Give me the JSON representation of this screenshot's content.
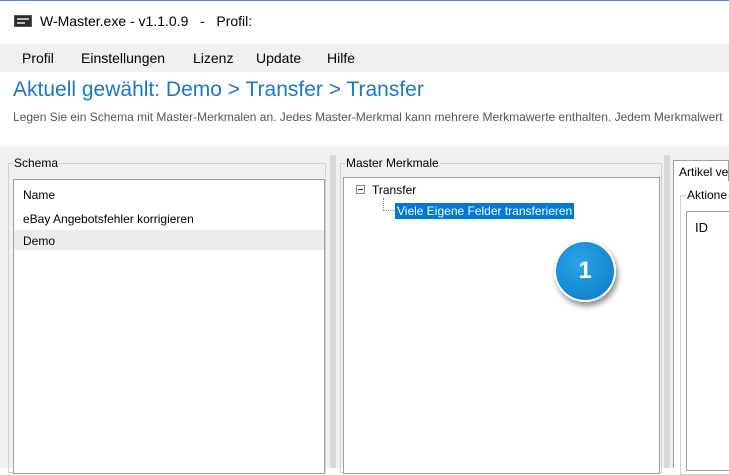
{
  "window": {
    "title": "W-Master.exe - v1.1.0.9   -   Profil:",
    "icon": "app-logo-icon"
  },
  "menu": {
    "items": [
      "Profil",
      "Einstellungen",
      "Lizenz",
      "Update",
      "Hilfe"
    ]
  },
  "header": {
    "current_selection": "Aktuell gewählt: Demo > Transfer > Transfer",
    "description": "Legen Sie ein Schema mit Master-Merkmalen an. Jedes Master-Merkmal kann mehrere Merkmawerte enthalten. Jedem Merkmalwert"
  },
  "schema_panel": {
    "label": "Schema",
    "column_header": "Name",
    "rows": [
      "eBay Angebotsfehler korrigieren",
      "Demo"
    ],
    "selected_row": "Demo"
  },
  "master_panel": {
    "label": "Master Merkmale",
    "tree": {
      "root": "Transfer",
      "root_expanded": true,
      "children": [
        "Viele Eigene Felder transferieren"
      ],
      "selected_child": "Viele Eigene Felder transferieren"
    }
  },
  "badge": {
    "number": "1"
  },
  "article_panel": {
    "tab_label": "Artikel ve",
    "group_label": "Aktione",
    "column_header": "ID"
  },
  "colors": {
    "accent": "#1a77c9",
    "selection": "#0078d7",
    "badge": "#1a8fd8"
  }
}
